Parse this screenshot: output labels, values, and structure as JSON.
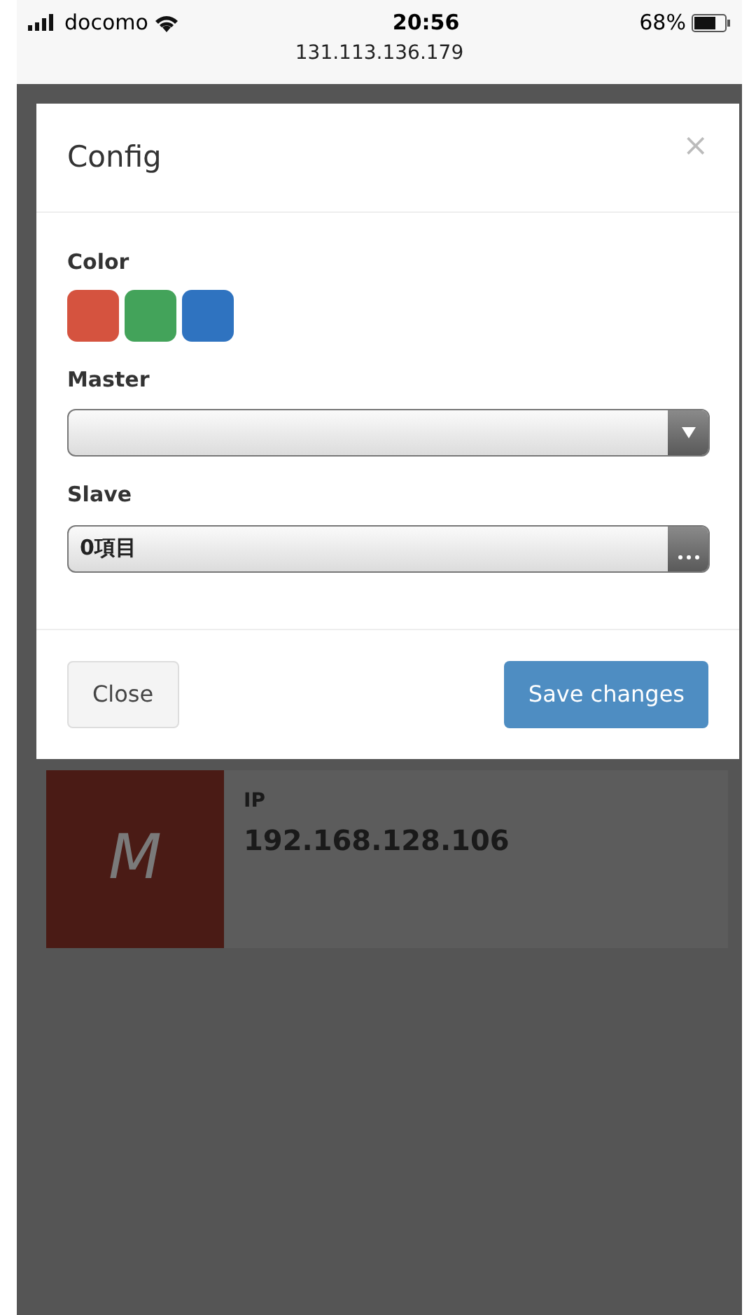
{
  "status_bar": {
    "carrier": "docomo",
    "time": "20:56",
    "battery": "68%",
    "url": "131.113.136.179"
  },
  "modal": {
    "title": "Config",
    "close_symbol": "×",
    "color_label": "Color",
    "swatches": [
      {
        "color": "#d5533f"
      },
      {
        "color": "#43a35a"
      },
      {
        "color": "#2f73c0"
      }
    ],
    "fields": [
      {
        "label": "Master",
        "kind": "select"
      },
      {
        "label": "Slave",
        "kind": "multi",
        "value": "0項目"
      }
    ],
    "buttons": [
      {
        "label": "Close",
        "kind": "default"
      },
      {
        "label": "Save changes",
        "kind": "primary"
      }
    ]
  },
  "device_card": {
    "initial": "M",
    "ip_label": "IP",
    "ip": "192.168.128.106"
  }
}
